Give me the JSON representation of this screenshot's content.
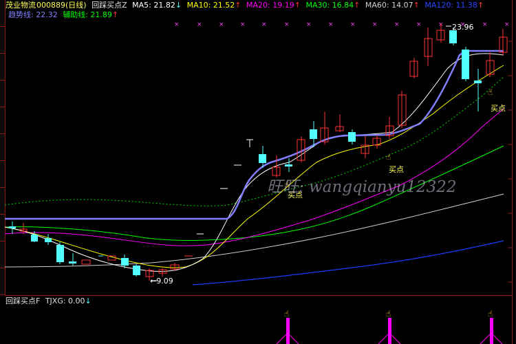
{
  "header": {
    "stock_name": "茂业物流",
    "stock_code": "000889",
    "period": "(日线)",
    "formula": "回踩买点Z",
    "ma5": "MA5: 21.82",
    "ma10": "MA10: 21.52",
    "ma20": "MA20: 19.19",
    "ma30": "MA30: 16.84",
    "ma60": "MA60: 14.07",
    "ma120": "MA120: 11.38",
    "trend_line": "趋势线: 22.32",
    "aux_line": "辅助线: 21.89"
  },
  "colors": {
    "ma5": "#ffffff",
    "ma10": "#ffff00",
    "ma20": "#ff00ff",
    "ma30": "#00ff00",
    "ma60": "#d0d0d0",
    "ma120": "#1e3cff",
    "trend": "#8080ff",
    "aux": "#00ff00",
    "up_candle": "#ff3232",
    "down_candle": "#54ffff",
    "grid": "#8b1a1a"
  },
  "annotations": {
    "high_label": "23.96",
    "low_label": "9.09",
    "buy_label": "买点",
    "watermark": "旺旺: wangqianyu12322"
  },
  "indicator": {
    "name": "回踩买点F",
    "value": "TJXG: 0.00"
  },
  "icons": {
    "hand": "pointing-hand-icon",
    "arrow_down": "arrow-down-icon",
    "arrow_up": "arrow-up-icon"
  }
}
